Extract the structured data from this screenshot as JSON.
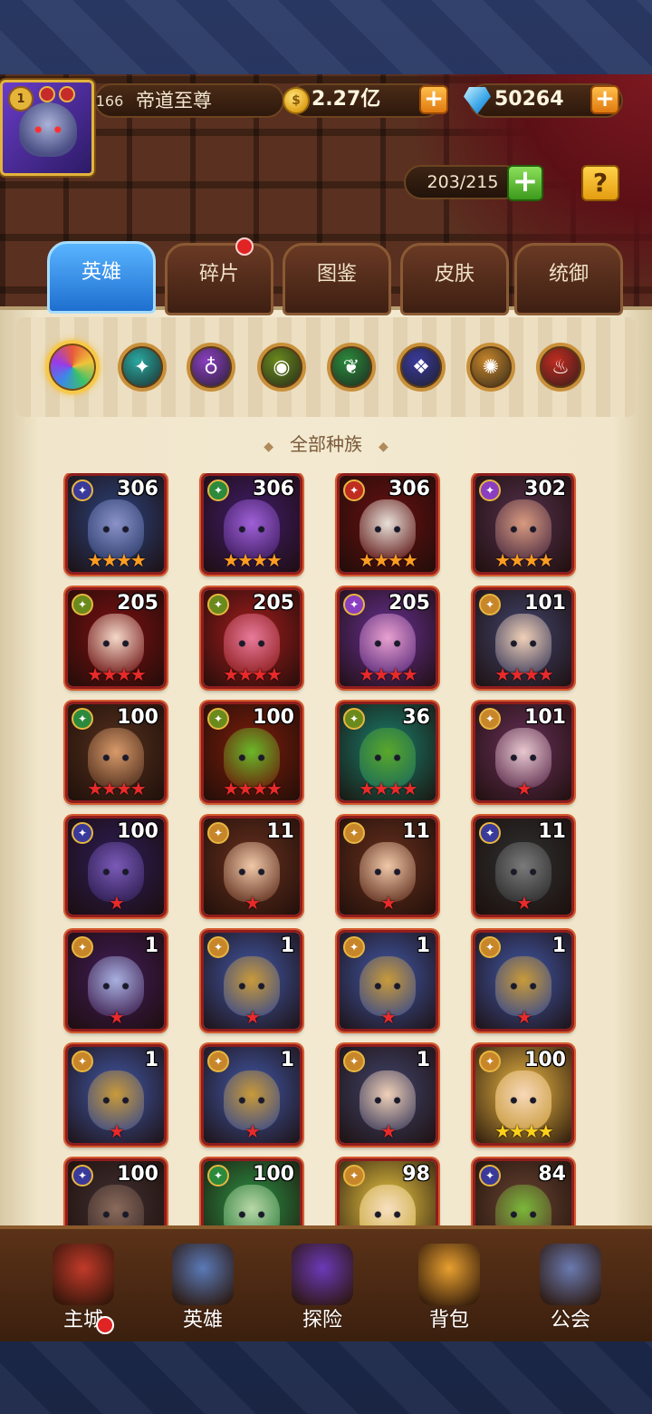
{
  "player": {
    "level": "166",
    "name": "帝道至尊",
    "avatar_badge": "1"
  },
  "resources": {
    "gold": "2.27亿",
    "gems": "50264"
  },
  "hero_count": "203/215",
  "help_label": "?",
  "tabs": [
    {
      "label": "英雄",
      "active": true
    },
    {
      "label": "碎片",
      "active": false,
      "badge": true
    },
    {
      "label": "图鉴",
      "active": false
    },
    {
      "label": "皮肤",
      "active": false
    },
    {
      "label": "统御",
      "active": false
    }
  ],
  "races": [
    {
      "name": "all-races",
      "color": "#e85a3a",
      "active": true
    },
    {
      "name": "race-shadow",
      "color": "#2aa8a0"
    },
    {
      "name": "race-fortress",
      "color": "#8a3fc0"
    },
    {
      "name": "race-abyss",
      "color": "#6a8a1c"
    },
    {
      "name": "race-forest",
      "color": "#2c8a3c"
    },
    {
      "name": "race-dark",
      "color": "#3a3a9a"
    },
    {
      "name": "race-light",
      "color": "#c8862a"
    },
    {
      "name": "race-inferno",
      "color": "#c02c20"
    }
  ],
  "filter_title": "全部种族",
  "heroes": [
    {
      "level": "306",
      "race_color": "#3a3a9a",
      "stars": "★★★★",
      "star_color": "#ff9d20",
      "bg": "#2a3a6a",
      "face": "#8a92c8"
    },
    {
      "level": "306",
      "race_color": "#2c8a3c",
      "stars": "★★★★",
      "star_color": "#ff9d20",
      "bg": "#3a1a5a",
      "face": "#a060d8"
    },
    {
      "level": "306",
      "race_color": "#c02c20",
      "stars": "★★★★",
      "star_color": "#ff9d20",
      "bg": "#5a1010",
      "face": "#e8e0d8"
    },
    {
      "level": "302",
      "race_color": "#8a3fc0",
      "stars": "★★★★",
      "star_color": "#ff9d20",
      "bg": "#4a2a40",
      "face": "#d89a80"
    },
    {
      "level": "205",
      "race_color": "#6a8a1c",
      "stars": "★★★★",
      "star_color": "#e82a2a",
      "bg": "#6a1010",
      "face": "#f5d8c8"
    },
    {
      "level": "205",
      "race_color": "#6a8a1c",
      "stars": "★★★★",
      "star_color": "#e82a2a",
      "bg": "#8a1a1a",
      "face": "#e87a9a"
    },
    {
      "level": "205",
      "race_color": "#8a3fc0",
      "stars": "★★★★",
      "star_color": "#e82a2a",
      "bg": "#5a2a7a",
      "face": "#e8a0d0"
    },
    {
      "level": "101",
      "race_color": "#c8862a",
      "stars": "★★★★",
      "star_color": "#e82a2a",
      "bg": "#3a3a5a",
      "face": "#f0d0b8"
    },
    {
      "level": "100",
      "race_color": "#2c8a3c",
      "stars": "★★★★",
      "star_color": "#e82a2a",
      "bg": "#4a2a1a",
      "face": "#d89a6a"
    },
    {
      "level": "100",
      "race_color": "#6a8a1c",
      "stars": "★★★★",
      "star_color": "#e82a2a",
      "bg": "#6a1a0a",
      "face": "#6ab82a"
    },
    {
      "level": "36",
      "race_color": "#6a8a1c",
      "stars": "★★★★",
      "star_color": "#e82a2a",
      "bg": "#1a6a5a",
      "face": "#5aa82a"
    },
    {
      "level": "101",
      "race_color": "#c8862a",
      "stars": "★",
      "star_color": "#e82a2a",
      "bg": "#5a2a4a",
      "face": "#e8c8d0"
    },
    {
      "level": "100",
      "race_color": "#3a3a9a",
      "stars": "★",
      "star_color": "#e82a2a",
      "bg": "#2a1a4a",
      "face": "#7a5ab8"
    },
    {
      "level": "11",
      "race_color": "#c8862a",
      "stars": "★",
      "star_color": "#e82a2a",
      "bg": "#5a2a1a",
      "face": "#f0c8a8"
    },
    {
      "level": "11",
      "race_color": "#c8862a",
      "stars": "★",
      "star_color": "#e82a2a",
      "bg": "#5a2a1a",
      "face": "#f0c8a8"
    },
    {
      "level": "11",
      "race_color": "#3a3a9a",
      "stars": "★",
      "star_color": "#e82a2a",
      "bg": "#2a2a2a",
      "face": "#7a7a7a"
    },
    {
      "level": "1",
      "race_color": "#c8862a",
      "stars": "★",
      "star_color": "#e82a2a",
      "bg": "#3a1a4a",
      "face": "#a8b0e0"
    },
    {
      "level": "1",
      "race_color": "#c8862a",
      "stars": "★",
      "star_color": "#e82a2a",
      "bg": "#3a4a8a",
      "face": "#c89a3a"
    },
    {
      "level": "1",
      "race_color": "#c8862a",
      "stars": "★",
      "star_color": "#e82a2a",
      "bg": "#3a4a8a",
      "face": "#c89a3a"
    },
    {
      "level": "1",
      "race_color": "#c8862a",
      "stars": "★",
      "star_color": "#e82a2a",
      "bg": "#3a4a8a",
      "face": "#c89a3a"
    },
    {
      "level": "1",
      "race_color": "#c8862a",
      "stars": "★",
      "star_color": "#e82a2a",
      "bg": "#3a4a8a",
      "face": "#c89a3a"
    },
    {
      "level": "1",
      "race_color": "#c8862a",
      "stars": "★",
      "star_color": "#e82a2a",
      "bg": "#3a4a8a",
      "face": "#c89a3a"
    },
    {
      "level": "1",
      "race_color": "#c8862a",
      "stars": "★",
      "star_color": "#e82a2a",
      "bg": "#3a3a5a",
      "face": "#f0d0b8"
    },
    {
      "level": "100",
      "race_color": "#c8862a",
      "stars": "★★★★",
      "star_color": "#ffd21a",
      "bg": "#c89a3a",
      "face": "#f8d8b8"
    },
    {
      "level": "100",
      "race_color": "#3a3a9a",
      "stars": "",
      "star_color": "#e82a2a",
      "bg": "#3a2a2a",
      "face": "#8a6a5a"
    },
    {
      "level": "100",
      "race_color": "#2c8a3c",
      "stars": "",
      "star_color": "#e82a2a",
      "bg": "#2a7a3a",
      "face": "#b8d8a8"
    },
    {
      "level": "98",
      "race_color": "#c8862a",
      "stars": "",
      "star_color": "#e82a2a",
      "bg": "#c8a83a",
      "face": "#f8e0c0"
    },
    {
      "level": "84",
      "race_color": "#3a3a9a",
      "stars": "",
      "star_color": "#e82a2a",
      "bg": "#5a3a2a",
      "face": "#7ab83a"
    }
  ],
  "nav": [
    {
      "label": "主城",
      "icon": "castle-icon",
      "color": "#c23a2a",
      "badge": true
    },
    {
      "label": "英雄",
      "icon": "hero-portrait-icon",
      "color": "#5a7ab8"
    },
    {
      "label": "探险",
      "icon": "portal-icon",
      "color": "#6a3ab8"
    },
    {
      "label": "背包",
      "icon": "backpack-icon",
      "color": "#e8a030"
    },
    {
      "label": "公会",
      "icon": "guild-tower-icon",
      "color": "#6a7ab0"
    }
  ]
}
